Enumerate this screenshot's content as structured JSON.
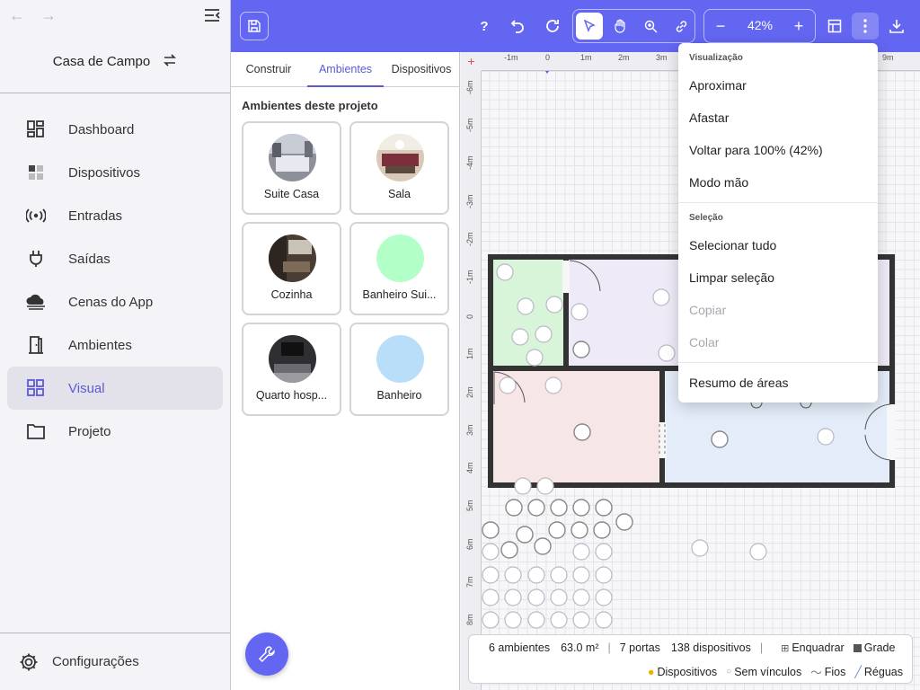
{
  "sidebar": {
    "project_name": "Casa de Campo",
    "nav": [
      {
        "label": "Dashboard",
        "icon": "dashboard-icon"
      },
      {
        "label": "Dispositivos",
        "icon": "devices-icon"
      },
      {
        "label": "Entradas",
        "icon": "signal-icon"
      },
      {
        "label": "Saídas",
        "icon": "plug-icon"
      },
      {
        "label": "Cenas do App",
        "icon": "cloud-icon"
      },
      {
        "label": "Ambientes",
        "icon": "door-icon"
      },
      {
        "label": "Visual",
        "icon": "grid-icon",
        "active": true
      },
      {
        "label": "Projeto",
        "icon": "folder-icon"
      }
    ],
    "settings_label": "Configurações"
  },
  "toolbar": {
    "help_label": "?",
    "zoom_value": "42%",
    "zoom_out_label": "−",
    "zoom_in_label": "+"
  },
  "panel": {
    "tabs": [
      "Construir",
      "Ambientes",
      "Dispositivos"
    ],
    "active_tab": "Ambientes",
    "title": "Ambientes deste projeto",
    "rooms": [
      {
        "name": "Suite Casa",
        "avatar": "photo",
        "color": "#b9bcc4"
      },
      {
        "name": "Sala",
        "avatar": "photo",
        "color": "#c9a98f"
      },
      {
        "name": "Cozinha",
        "avatar": "photo",
        "color": "#6d5a4a"
      },
      {
        "name": "Banheiro Sui...",
        "avatar": "color",
        "color": "#b3ffc8"
      },
      {
        "name": "Quarto hosp...",
        "avatar": "photo",
        "color": "#3a3a40"
      },
      {
        "name": "Banheiro",
        "avatar": "color",
        "color": "#b8def9"
      }
    ]
  },
  "rulers": {
    "h_ticks": [
      "-1m",
      "0",
      "1m",
      "2m",
      "3m",
      "9m"
    ],
    "v_ticks": [
      "-6m",
      "-5m",
      "-4m",
      "-3m",
      "-2m",
      "-1m",
      "0",
      "1m",
      "2m",
      "3m",
      "4m",
      "5m",
      "6m",
      "7m",
      "8m"
    ]
  },
  "menu": {
    "section_view": "Visualização",
    "zoom_in": "Aproximar",
    "zoom_out": "Afastar",
    "reset_zoom": "Voltar para 100% (42%)",
    "hand_mode": "Modo mão",
    "section_selection": "Seleção",
    "select_all": "Selecionar tudo",
    "clear_selection": "Limpar seleção",
    "copy": "Copiar",
    "paste": "Colar",
    "area_summary": "Resumo de áreas"
  },
  "status": {
    "rooms": "6 ambientes",
    "area": "63.0 m²",
    "doors": "7 portas",
    "devices": "138 dispositivos",
    "snap": "Enquadrar",
    "grid": "Grade",
    "layer_devices": "Dispositivos",
    "layer_unlinked": "Sem vínculos",
    "layer_wires": "Fios",
    "layer_rulers": "Réguas"
  },
  "colors": {
    "accent": "#6366f1",
    "sidebar_active": "#e3e2ea",
    "room_green": "#d8f5da",
    "room_lavender": "#eeeaf7",
    "room_pink": "#f7e6e6",
    "room_blue": "#e3ecf8",
    "wall": "#333333"
  }
}
